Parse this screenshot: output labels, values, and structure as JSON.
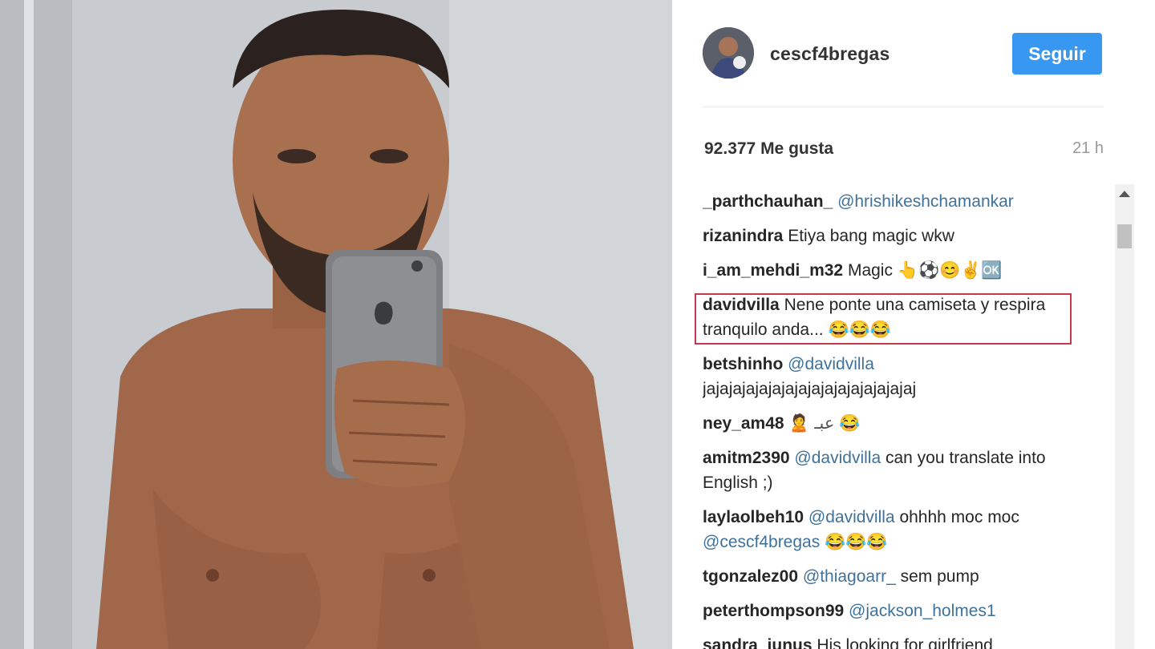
{
  "post": {
    "username": "cescf4bregas",
    "follow_label": "Seguir",
    "likes": "92.377 Me gusta",
    "time": "21 h"
  },
  "comments": [
    {
      "user": "_parthchauhan_",
      "mention": "@hrishikeshchamankar",
      "text": ""
    },
    {
      "user": "rizanindra",
      "mention": "",
      "text": "Etiya bang magic wkw"
    },
    {
      "user": "i_am_mehdi_m32",
      "mention": "",
      "text": "Magic 👆⚽😊✌🆗"
    },
    {
      "user": "davidvilla",
      "mention": "",
      "text": "Nene ponte una camiseta y respira tranquilo anda... 😂😂😂"
    },
    {
      "user": "betshinho",
      "mention": "@davidvilla",
      "text": "jajajajajajajajajajajajajajajajaj"
    },
    {
      "user": "ney_am48",
      "mention": "",
      "text": "🙎 عبـ 😂"
    },
    {
      "user": "amitm2390",
      "mention": "@davidvilla",
      "text": "can you translate into English ;)"
    },
    {
      "user": "laylaolbeh10",
      "mention": "@davidvilla",
      "text": "ohhhh moc moc",
      "mention2": "@cescf4bregas",
      "text2": "😂😂😂"
    },
    {
      "user": "tgonzalez00",
      "mention": "@thiagoarr_",
      "text": "sem pump"
    },
    {
      "user": "peterthompson99",
      "mention": "@jackson_holmes1",
      "text": ""
    },
    {
      "user": "sandra_junus",
      "mention": "",
      "text": "His looking for girlfriend"
    }
  ],
  "icons": {
    "avatar": "profile-photo",
    "scroll_up": "arrow-up-icon"
  },
  "colors": {
    "follow_button": "#3897f0",
    "mention": "#3f729b",
    "highlight_box": "#c43a4a"
  }
}
